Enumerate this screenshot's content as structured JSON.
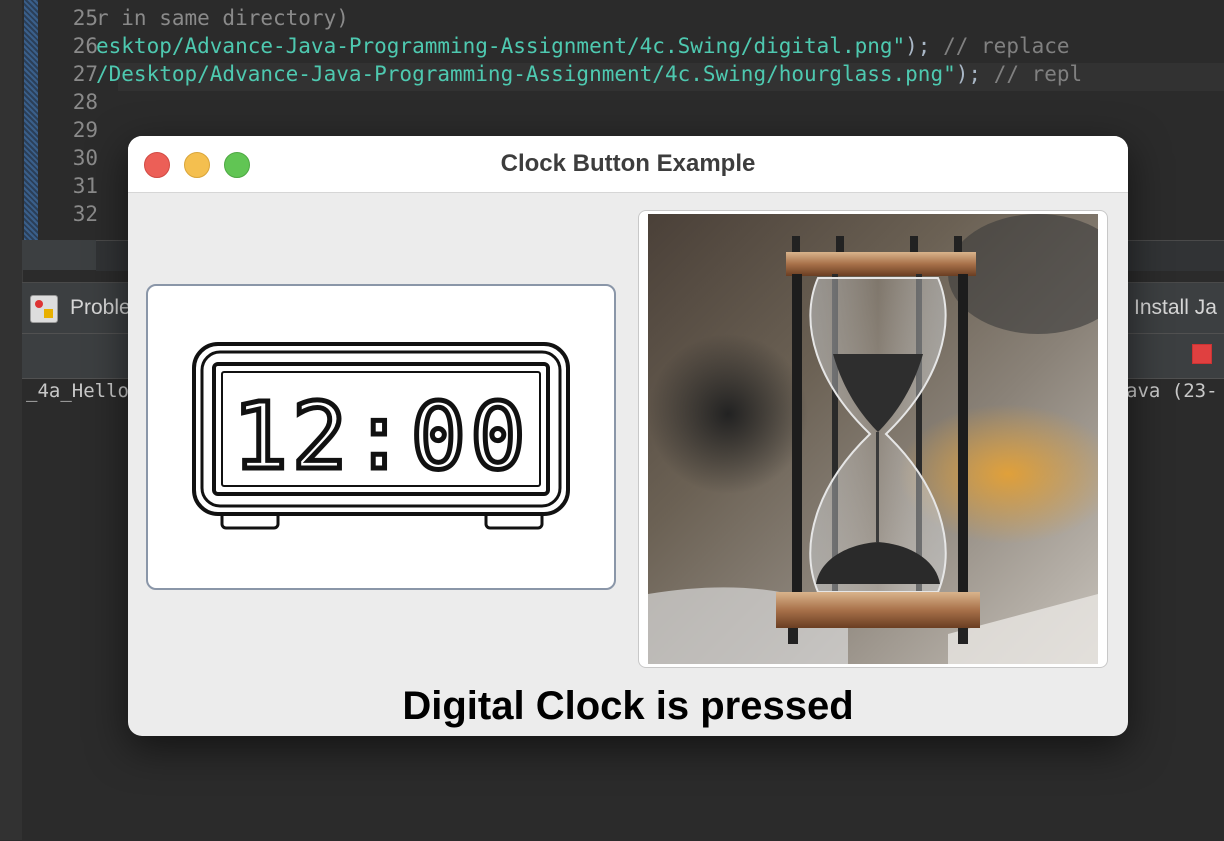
{
  "editor": {
    "lines": [
      {
        "num": "25",
        "text": "r in same directory)"
      },
      {
        "num": "26",
        "path": "esktop/Advance-Java-Programming-Assignment/4c.Swing/digital.png\"",
        "tail": ");",
        "comment": "// replace"
      },
      {
        "num": "27",
        "path": "/Desktop/Advance-Java-Programming-Assignment/4c.Swing/hourglass.png\"",
        "tail": ");",
        "comment": "// repl"
      },
      {
        "num": "28",
        "text": ""
      },
      {
        "num": "29",
        "text": ""
      },
      {
        "num": "30",
        "text": ""
      },
      {
        "num": "31",
        "text": ""
      },
      {
        "num": "32",
        "text": ""
      }
    ]
  },
  "panel": {
    "problems_tab": "Proble",
    "install_tab": "Install Ja",
    "console_left": "_4a_Hello",
    "console_right": "ava (23-"
  },
  "window": {
    "title": "Clock Button Example",
    "digital_button": {
      "display": "12:00",
      "icon": "digital-clock-icon"
    },
    "hourglass_button": {
      "icon": "hourglass-icon"
    },
    "status": "Digital Clock is pressed"
  },
  "colors": {
    "close": "#ec5f57",
    "minimize": "#f4bf4f",
    "maximize": "#61c554"
  }
}
